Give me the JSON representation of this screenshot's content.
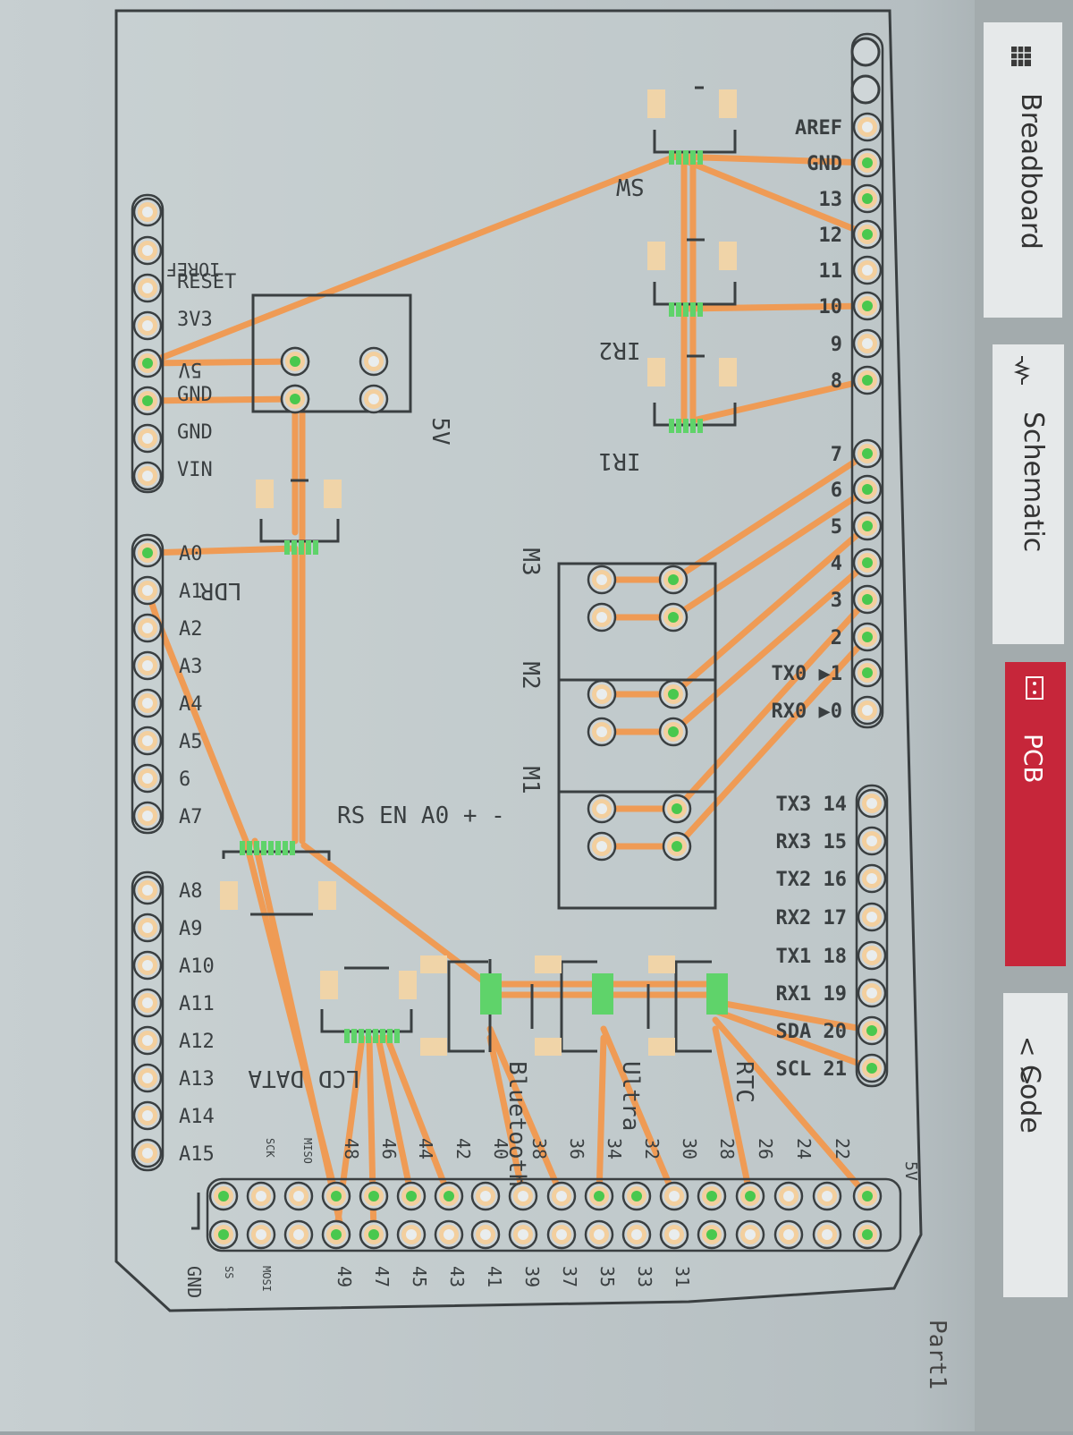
{
  "tabs": {
    "breadboard": "Breadboard",
    "schematic": "Schematic",
    "pcb": "PCB",
    "code": "Code"
  },
  "status_label": "Part1",
  "icons": {
    "breadboard": "breadboard-grid-icon",
    "schematic": "resistor-icon",
    "pcb": "pcb-board-icon",
    "code": "code-brackets-icon"
  },
  "colors": {
    "trace": "#ef9b55",
    "pad_green": "#49c84e",
    "pad_ring": "#f3cf9e",
    "silk": "#3a3f41",
    "active_tab": "#c6263a"
  },
  "top_header": [
    "AREF",
    "GND",
    "13",
    "12",
    "11",
    "10",
    "9",
    "8",
    "7",
    "6",
    "5",
    "4",
    "3",
    "2",
    "TX0 ▶1",
    "RX0 ▶0",
    "TX3 14",
    "RX3 15",
    "TX2 16",
    "RX2 17",
    "TX1 18",
    "RX1 19",
    "SDA 20",
    "SCL 21"
  ],
  "power_header": [
    "IOREF",
    "RESET",
    "3V3",
    "5V",
    "GND",
    "GND",
    "VIN"
  ],
  "analog_header": [
    "A0",
    "A1",
    "A2",
    "A3",
    "A4",
    "A5",
    "6",
    "A7",
    "A8",
    "A9",
    "A10",
    "A11",
    "A12",
    "A13",
    "A14",
    "A15"
  ],
  "digital_even": [
    "22",
    "24",
    "26",
    "28",
    "30",
    "32",
    "34",
    "36",
    "38",
    "40",
    "42",
    "44",
    "46",
    "48",
    "MISO",
    "SCK"
  ],
  "digital_odd": [
    "31",
    "33",
    "35",
    "37",
    "39",
    "41",
    "43",
    "45",
    "47",
    "49",
    "MOSI",
    "SS",
    "GND"
  ],
  "pin_5v_label": "5V",
  "components": {
    "sw": "SW",
    "ir2": "IR2",
    "ir1": "IR1",
    "m3": "M3",
    "m2": "M2",
    "m1": "M1",
    "ldr": "LDR",
    "power_5v": "5V",
    "lcd_data": "LCD DATA",
    "bluetooth": "Bluetooth",
    "ultra": "Ultra",
    "rtc": "RTC",
    "lcd_ctrl": "RS  EN  A0  +  -"
  }
}
